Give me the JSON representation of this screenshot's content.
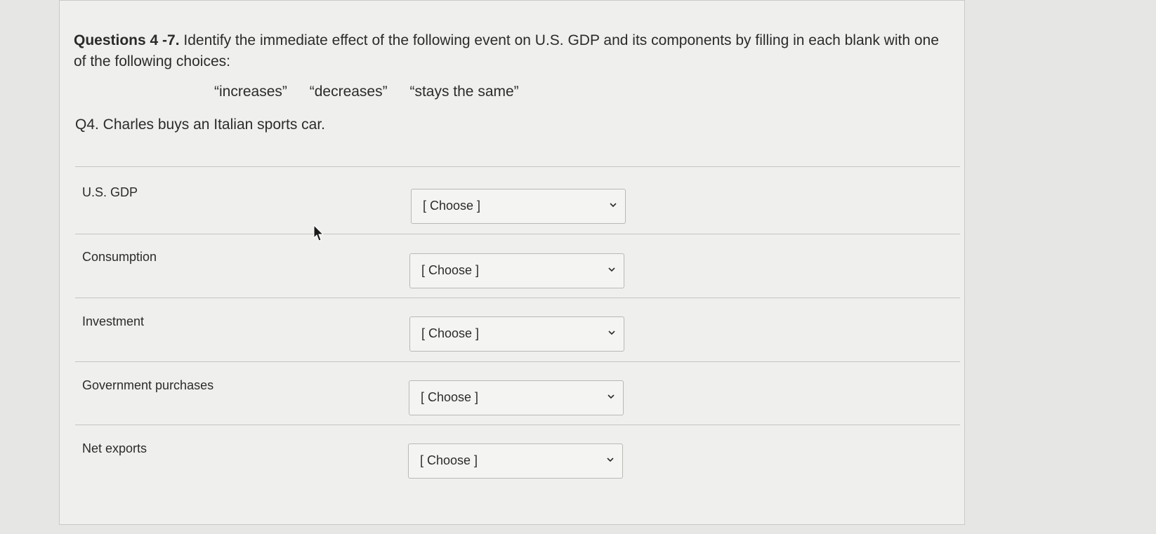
{
  "prompt": {
    "heading_bold": "Questions 4 -7.",
    "text": " Identify the immediate effect of the following event on U.S. GDP and its components by filling in each blank with one of the following choices:"
  },
  "choices": [
    "“increases”",
    "“decreases”",
    "“stays the same”"
  ],
  "question": "Q4. Charles buys an Italian sports car.",
  "rows": [
    {
      "label": "U.S. GDP",
      "selected": "[ Choose ]"
    },
    {
      "label": "Consumption",
      "selected": "[ Choose ]"
    },
    {
      "label": "Investment",
      "selected": "[ Choose ]"
    },
    {
      "label": "Government purchases",
      "selected": "[ Choose ]"
    },
    {
      "label": "Net exports",
      "selected": "[ Choose ]"
    }
  ],
  "icons": {
    "dropdown": "chevron-down-icon",
    "cursor": "mouse-pointer-icon"
  }
}
